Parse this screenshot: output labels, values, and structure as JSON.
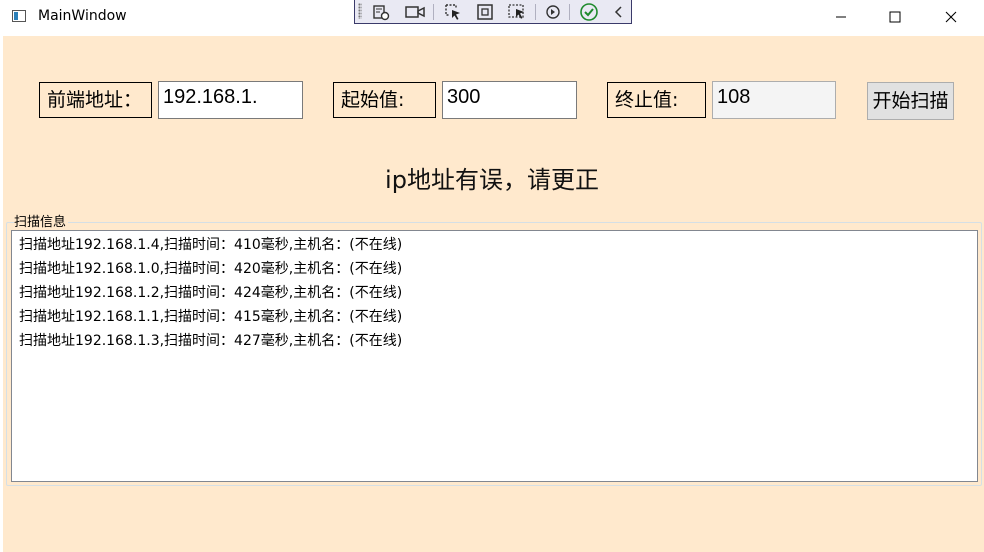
{
  "window": {
    "title": "MainWindow"
  },
  "debug_toolbar": {
    "icons": [
      "live-visual-tree-icon",
      "record-icon",
      "select-element-icon",
      "display-layout-adorners-icon",
      "track-focus-icon",
      "hot-reload-icon",
      "hot-reload-ok-icon",
      "collapse-chevron-icon"
    ]
  },
  "form": {
    "prefix_label": "前端地址：",
    "prefix_value": "192.168.1.",
    "start_label": "起始值:",
    "start_value": "300",
    "end_label": "终止值:",
    "end_value": "108",
    "scan_button": "开始扫描"
  },
  "status_message": "ip地址有误，请更正",
  "scan_group": {
    "title": "扫描信息",
    "items": [
      "扫描地址192.168.1.4,扫描时间：410毫秒,主机名：(不在线)",
      "扫描地址192.168.1.0,扫描时间：420毫秒,主机名：(不在线)",
      "扫描地址192.168.1.2,扫描时间：424毫秒,主机名：(不在线)",
      "扫描地址192.168.1.1,扫描时间：415毫秒,主机名：(不在线)",
      "扫描地址192.168.1.3,扫描时间：427毫秒,主机名：(不在线)"
    ]
  }
}
